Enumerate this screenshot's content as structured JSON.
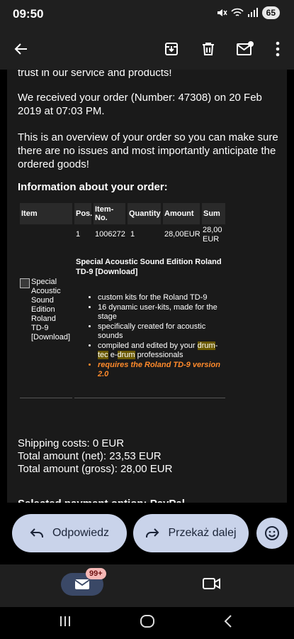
{
  "status_bar": {
    "time": "09:50",
    "battery": "65"
  },
  "email": {
    "cut_top_line": "trust in our service and products!",
    "order_received": "We received your order (Number: 47308) on 20 Feb 2019 at 07:03 PM.",
    "overview": "This is an overview of your order so you can make sure there are no issues and most importantly anticipate the ordered goods!",
    "info_heading": "Information about your order:",
    "table": {
      "headers": [
        "Item",
        "Pos.",
        "Item-No.",
        "Quantity",
        "Amount",
        "Sum"
      ],
      "row": {
        "pos": "1",
        "item_no": "1006272",
        "quantity": "1",
        "amount": "28,00EUR",
        "sum": "28,00 EUR"
      },
      "product_title": "Special Acoustic Sound Edition Roland TD-9 [Download]",
      "image_alt": "Special Acoustic Sound Edition Roland TD-9 [Download]",
      "bullets": [
        "custom kits for the Roland TD-9",
        "16 dynamic user-kits, made for the stage",
        "specifically created for acoustic sounds"
      ],
      "bullet4": {
        "pre": "compiled and edited by your ",
        "h1": "drum",
        "dash": "-",
        "h2": "tec",
        "mid": " e-",
        "h3": "drum",
        "post": " professionals"
      },
      "requirement": "requires the Roland TD-9 version 2.0"
    },
    "shipping": "Shipping costs: 0 EUR",
    "total_net": "Total amount (net): 23,53 EUR",
    "total_gross": "Total amount (gross): 28,00 EUR",
    "cut_bottom_line": "Selected payment option: PayPal"
  },
  "actions": {
    "reply": "Odpowiedz",
    "forward": "Przekaż dalej"
  },
  "bottom_nav": {
    "mail_badge": "99+"
  },
  "colors": {
    "button_bg": "#c9d3ea",
    "highlight": "#6b5a00",
    "requirement": "#ff8a2b"
  }
}
